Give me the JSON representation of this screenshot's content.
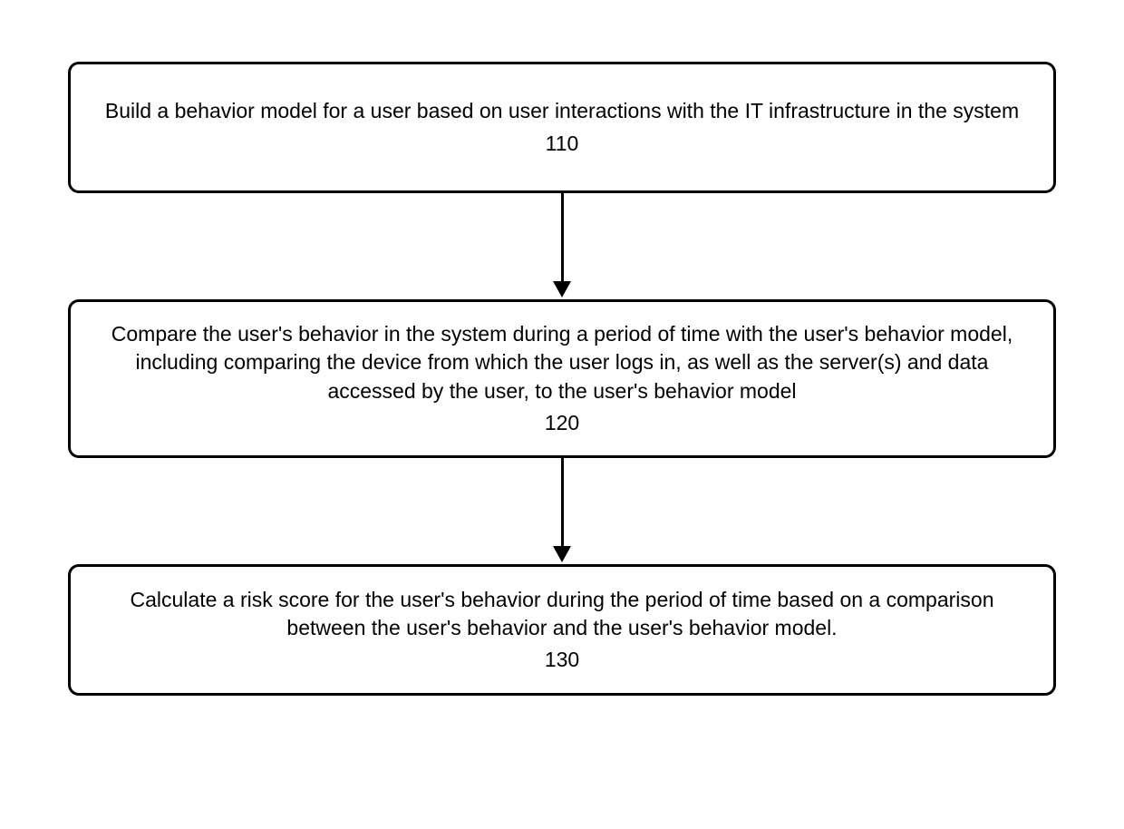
{
  "diagram": {
    "steps": [
      {
        "text": "Build a behavior model for a user based on user interactions with the IT infrastructure in the system",
        "num": "110"
      },
      {
        "text": "Compare the user's behavior in the system during a period of time with the user's behavior model, including comparing the device from which the user logs in, as well as the server(s) and data accessed by the user, to the user's behavior model",
        "num": "120"
      },
      {
        "text": "Calculate a risk score for the user's behavior during the period of time based on a comparison between the user's behavior and the user's behavior model.",
        "num": "130"
      }
    ]
  }
}
